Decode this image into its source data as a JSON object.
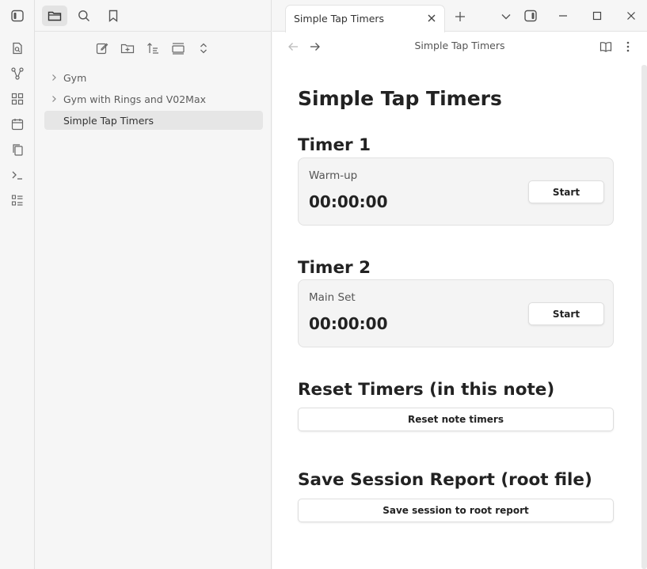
{
  "explorer": {
    "items": [
      {
        "label": "Gym",
        "type": "folder"
      },
      {
        "label": "Gym with Rings and V02Max",
        "type": "folder"
      },
      {
        "label": "Simple Tap Timers",
        "type": "file",
        "active": true
      }
    ]
  },
  "tab": {
    "title": "Simple Tap Timers"
  },
  "view": {
    "title": "Simple Tap Timers"
  },
  "note": {
    "title": "Simple Tap Timers",
    "timer1": {
      "heading": "Timer 1",
      "label": "Warm-up",
      "time": "00:00:00",
      "button": "Start"
    },
    "timer2": {
      "heading": "Timer 2",
      "label": "Main Set",
      "time": "00:00:00",
      "button": "Start"
    },
    "reset": {
      "heading": "Reset Timers (in this note)",
      "button": "Reset note timers"
    },
    "save": {
      "heading": "Save Session Report (root file)",
      "button": "Save session to root report"
    }
  },
  "colors": {
    "background": "#f6f6f6",
    "editor": "#ffffff",
    "card": "#f4f4f4",
    "text": "#222222"
  },
  "icons": {
    "ribbon": [
      "sidebar-toggle-icon",
      "search-note-icon",
      "graph-icon",
      "canvas-icon",
      "calendar-icon",
      "copy-icon",
      "terminal-icon",
      "list-icon"
    ],
    "explorer_tabs": [
      "folder-icon",
      "search-icon",
      "bookmark-icon"
    ],
    "explorer_actions": [
      "new-note-icon",
      "new-folder-icon",
      "sort-icon",
      "collapse-icon",
      "expand-icon"
    ]
  }
}
